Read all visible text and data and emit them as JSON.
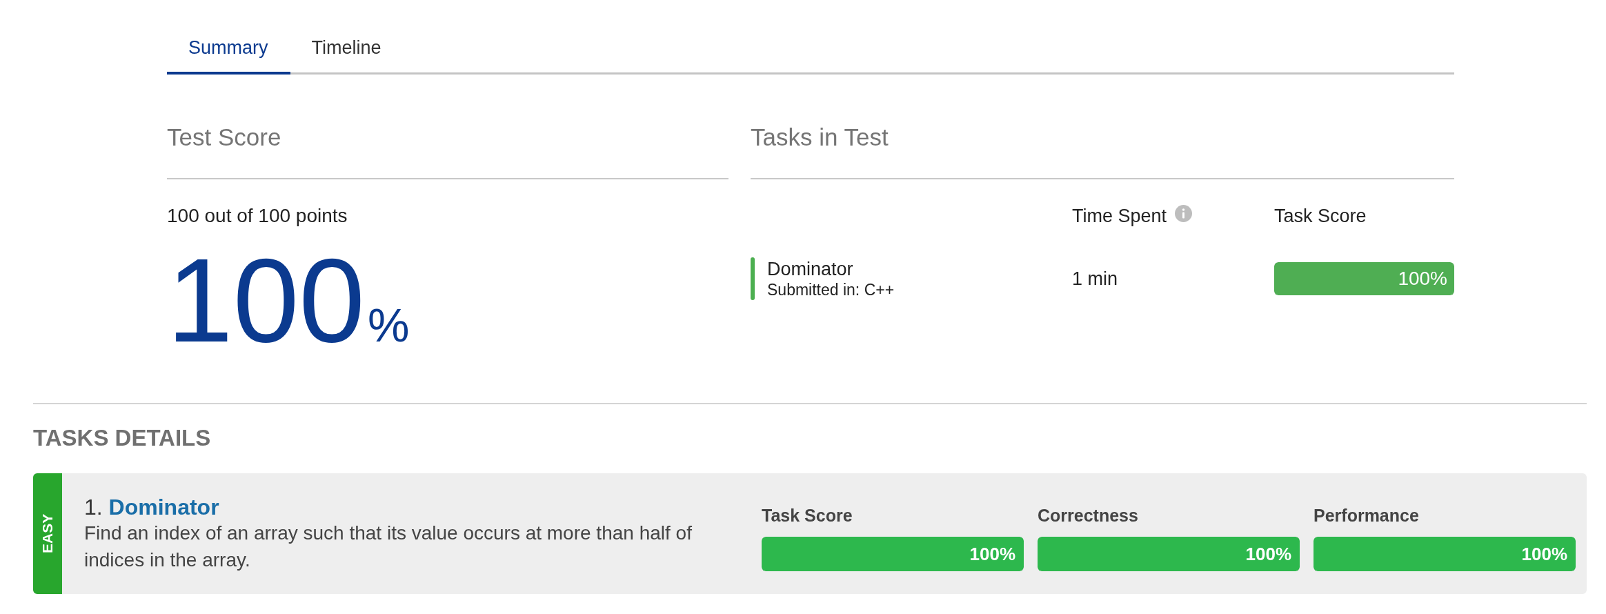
{
  "tabs": [
    {
      "label": "Summary",
      "selected": true
    },
    {
      "label": "Timeline",
      "selected": false
    }
  ],
  "test_score": {
    "title": "Test Score",
    "points": "100 out of 100 points",
    "score": "100",
    "unit": "%"
  },
  "tasks_in_test": {
    "title": "Tasks in Test",
    "columns": [
      {
        "label": "Time Spent",
        "info": true
      },
      {
        "label": "Task Score",
        "info": false
      }
    ],
    "tasks": [
      {
        "name": "Dominator",
        "language": "Submitted in: C++",
        "time": "1 min",
        "score": "100%",
        "level": 1
      }
    ]
  },
  "tasks_details": {
    "title": "TASKS DETAILS",
    "tasks": [
      {
        "difficulty": "EASY",
        "number": "1.",
        "name": "Dominator",
        "description": "Find an index of an array such that its value occurs at more than half of indices in the array.",
        "metrics": [
          {
            "label": "Task Score",
            "value": "100%",
            "level": 1
          },
          {
            "label": "Correctness",
            "value": "100%",
            "level": 1
          },
          {
            "label": "Performance",
            "value": "100%",
            "level": 1
          }
        ]
      }
    ]
  }
}
